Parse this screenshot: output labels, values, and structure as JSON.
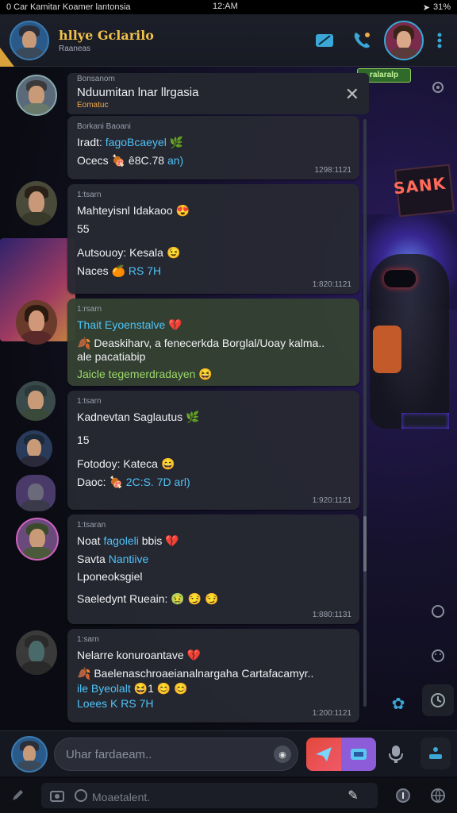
{
  "status_bar": {
    "left": "0 Car Kamitar Koamer lantonsia",
    "time": "12:AM",
    "battery": "31%"
  },
  "header": {
    "title": "hllye Gclarilo",
    "subtitle": "Raaneas"
  },
  "pinned": {
    "sender": "Bonsanom",
    "title": "Nduumitan lnar llrgasia",
    "subtitle": "Eomatuc",
    "badge": "ralaralp"
  },
  "messages": [
    {
      "sender": "Borkani Baoani",
      "lines": [
        {
          "pre": "Iradt: ",
          "hl": "fagoBcaeyel",
          "post": "",
          "emoji": "🌿"
        },
        {
          "pre": "Ocecs ",
          "hl": "",
          "post": "",
          "emoji": "",
          "stat_emoji": "🍖",
          "stat": "ê8C.78 ",
          "stat_hl": "an)"
        }
      ],
      "meta": "1298:1121",
      "green": false
    },
    {
      "sender": "1:tsarn",
      "lines": [
        {
          "pre": "Mahteyisnl Idakaoo",
          "hl": "",
          "post": "",
          "emoji": "😍"
        },
        {
          "pre": "55",
          "hl": "",
          "post": "",
          "emoji": ""
        },
        {
          "pre": "Autsouoy: Kesala",
          "hl": "",
          "post": "",
          "emoji": "😉"
        },
        {
          "pre": "Naces ",
          "hl": "",
          "post": "",
          "emoji": "",
          "stat_emoji": "🍊",
          "stat": "",
          "stat_hl": "RS 7H"
        }
      ],
      "meta": "1:820:1121",
      "green": false
    },
    {
      "sender": "1:rsarn",
      "lines": [
        {
          "pre": "",
          "hl": "Thait Eyoenstalve",
          "post": "",
          "emoji": "💔"
        },
        {
          "pre": "Deaskiharv, a fenecerkda Borglal/Uoay kalma..",
          "hl": "",
          "post": "",
          "emoji": "",
          "lead_emoji": "🍂"
        },
        {
          "pre": "ale pacatiabip",
          "hl": "",
          "post": "",
          "emoji": ""
        },
        {
          "pre": "",
          "hl": "",
          "post": "Jaicle tegemerdradayen",
          "emoji": "😆"
        }
      ],
      "meta": "",
      "green": true
    },
    {
      "sender": "1:tsarn",
      "lines": [
        {
          "pre": "Kadnevtan Saglautus",
          "hl": "",
          "post": "",
          "emoji": "🌿"
        },
        {
          "pre": "15",
          "hl": "",
          "post": "",
          "emoji": ""
        },
        {
          "pre": "Fotodoy: Kateca",
          "hl": "",
          "post": "",
          "emoji": "😄"
        },
        {
          "pre": "Daoc: ",
          "hl": "",
          "post": "",
          "emoji": "",
          "stat_emoji": "🍖",
          "stat": "",
          "stat_hl": "2C:S. 7D arl)"
        }
      ],
      "meta": "1:920:1121",
      "green": false
    },
    {
      "sender": "1:tsaran",
      "lines": [
        {
          "pre": "Noat ",
          "hl": "fagoleli",
          "post": " bbis",
          "emoji": "💔"
        },
        {
          "pre": "Savta ",
          "hl": "Nantiive",
          "post": "",
          "emoji": ""
        },
        {
          "pre": "Lponeoksgiel",
          "hl": "",
          "post": "",
          "emoji": ""
        },
        {
          "pre": "Saeledynt Rueain:",
          "hl": "",
          "post": "",
          "emoji": "🤢 😏 😏"
        }
      ],
      "meta": "1:880:1131",
      "green": false
    },
    {
      "sender": "1:sarn",
      "lines": [
        {
          "pre": "Nelarre konuroantave",
          "hl": "",
          "post": "",
          "emoji": "💔"
        },
        {
          "pre": "Baelenaschroaeianalnargaha Cartafacamyr..",
          "hl": "",
          "post": "",
          "emoji": "",
          "lead_emoji": "🍂"
        },
        {
          "pre": "",
          "hl": "ile Byeolalt",
          "post": "",
          "emoji": "😆1 😊 😊"
        },
        {
          "pre": "",
          "hl": "Loees K RS 7H",
          "post": "",
          "emoji": ""
        }
      ],
      "meta": "1:200:1121",
      "green": false
    }
  ],
  "compose": {
    "placeholder": "Uhar fardaeam.."
  },
  "bottom_bar": {
    "label": "Moaetalent."
  },
  "background": {
    "sign_text": "SANK"
  },
  "colors": {
    "accent_blue": "#4fc3f7",
    "accent_gold": "#f2c14a",
    "bubble_bg": "#262932",
    "green_bubble_bg": "#344232"
  },
  "icons": [
    "video-call-icon",
    "phone-icon",
    "more-vert-icon",
    "close-icon",
    "mic-icon",
    "send-icon",
    "attach-icon"
  ]
}
